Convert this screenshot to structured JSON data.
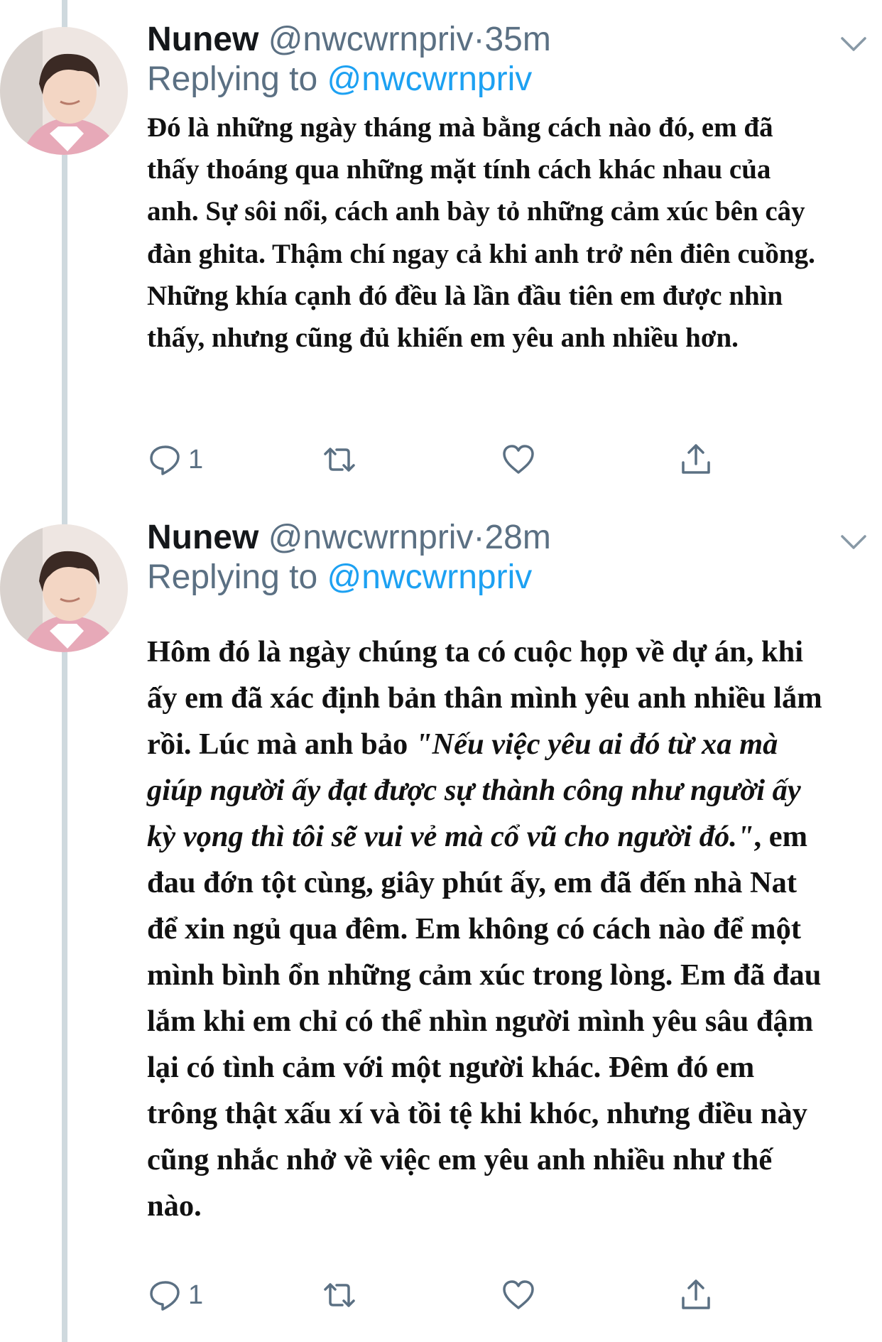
{
  "tweets": [
    {
      "name": "Nunew",
      "handle": "@nwcwrnpriv",
      "separator": "·",
      "time": "35m",
      "replying_prefix": "Replying to",
      "replying_handle": "@nwcwrnpriv",
      "text": "Đó là những ngày tháng mà bằng cách nào đó, em đã thấy thoáng qua những mặt tính cách khác nhau của anh. Sự sôi nổi, cách anh bày tỏ những cảm xúc bên cây đàn ghita. Thậm chí ngay cả khi anh trở nên điên cuồng. Những khía cạnh đó đều là lần đầu tiên em được nhìn thấy, nhưng cũng đủ khiến em yêu anh nhiều hơn.",
      "actions": {
        "reply_count": "1",
        "reply_icon": "speech-bubble-icon",
        "retweet_icon": "retweet-arrows-icon",
        "like_icon": "heart-icon",
        "share_icon": "share-upload-icon"
      }
    },
    {
      "name": "Nunew",
      "handle": "@nwcwrnpriv",
      "separator": "·",
      "time": "28m",
      "replying_prefix": "Replying to",
      "replying_handle": "@nwcwrnpriv",
      "text_before": "Hôm đó là ngày chúng ta có cuộc họp về dự án, khi ấy em đã xác định bản thân mình yêu anh nhiều lắm rồi. Lúc mà anh bảo ",
      "text_quote": "\"Nếu việc yêu ai đó từ xa mà giúp người ấy đạt được sự thành công như người ấy kỳ vọng thì tôi sẽ vui vẻ mà cổ vũ cho người đó.\"",
      "text_after": ", em đau đớn tột cùng, giây phút ấy, em đã đến nhà Nat để xin ngủ qua đêm. Em không có cách nào để một mình bình ổn những cảm xúc trong lòng. Em đã đau lắm khi em chỉ có thể nhìn người mình yêu sâu đậm lại có tình cảm với một người khác. Đêm đó em trông thật xấu xí và tồi tệ khi khóc, nhưng điều này cũng nhắc nhở về việc em yêu anh nhiều như thế nào.",
      "actions": {
        "reply_count": "1",
        "reply_icon": "speech-bubble-icon",
        "retweet_icon": "retweet-arrows-icon",
        "like_icon": "heart-icon",
        "share_icon": "share-upload-icon"
      }
    }
  ],
  "colors": {
    "name": "#14171a",
    "secondary": "#5b7083",
    "link": "#1da1f2",
    "body": "#111111",
    "thread_line": "#cfd9de"
  }
}
